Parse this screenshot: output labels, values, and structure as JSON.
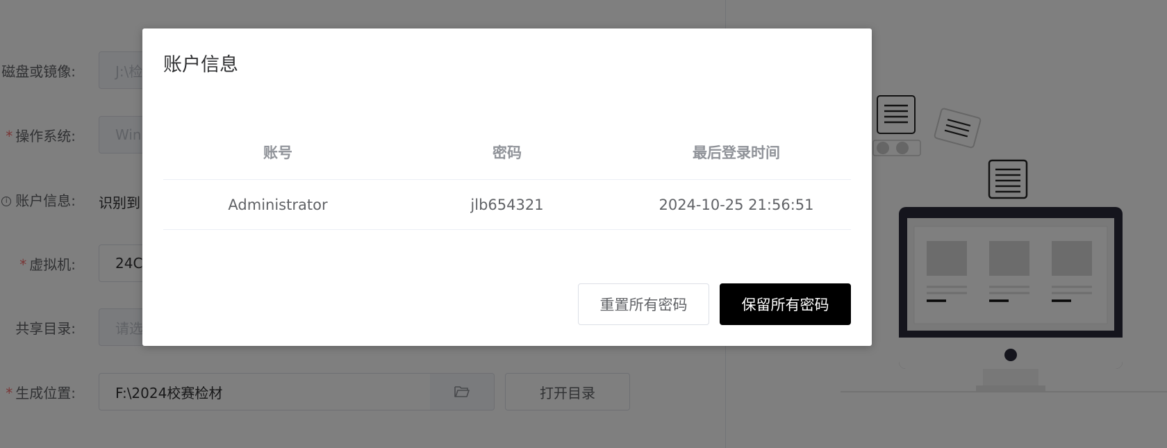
{
  "form": {
    "disk": {
      "label": "磁盘或镜像:",
      "value": "J:\\检"
    },
    "os": {
      "label": "操作系统:",
      "value": "Win"
    },
    "account": {
      "label": "账户信息:",
      "value": "识别到"
    },
    "vm": {
      "label": "虚拟机:",
      "value": "24C"
    },
    "share": {
      "label": "共享目录:",
      "placeholder": "请选"
    },
    "output": {
      "label": "生成位置:",
      "value": "F:\\2024校赛检材",
      "open_button": "打开目录"
    },
    "required_mark": "*",
    "info_mark": "i"
  },
  "dialog": {
    "title": "账户信息",
    "headers": [
      "账号",
      "密码",
      "最后登录时间"
    ],
    "rows": [
      [
        "Administrator",
        "jlb654321",
        "2024-10-25 21:56:51"
      ]
    ],
    "reset_button": "重置所有密码",
    "keep_button": "保留所有密码"
  },
  "icons": {
    "folder": "folder-open-icon",
    "illustration": "computer-documents-illustration"
  }
}
